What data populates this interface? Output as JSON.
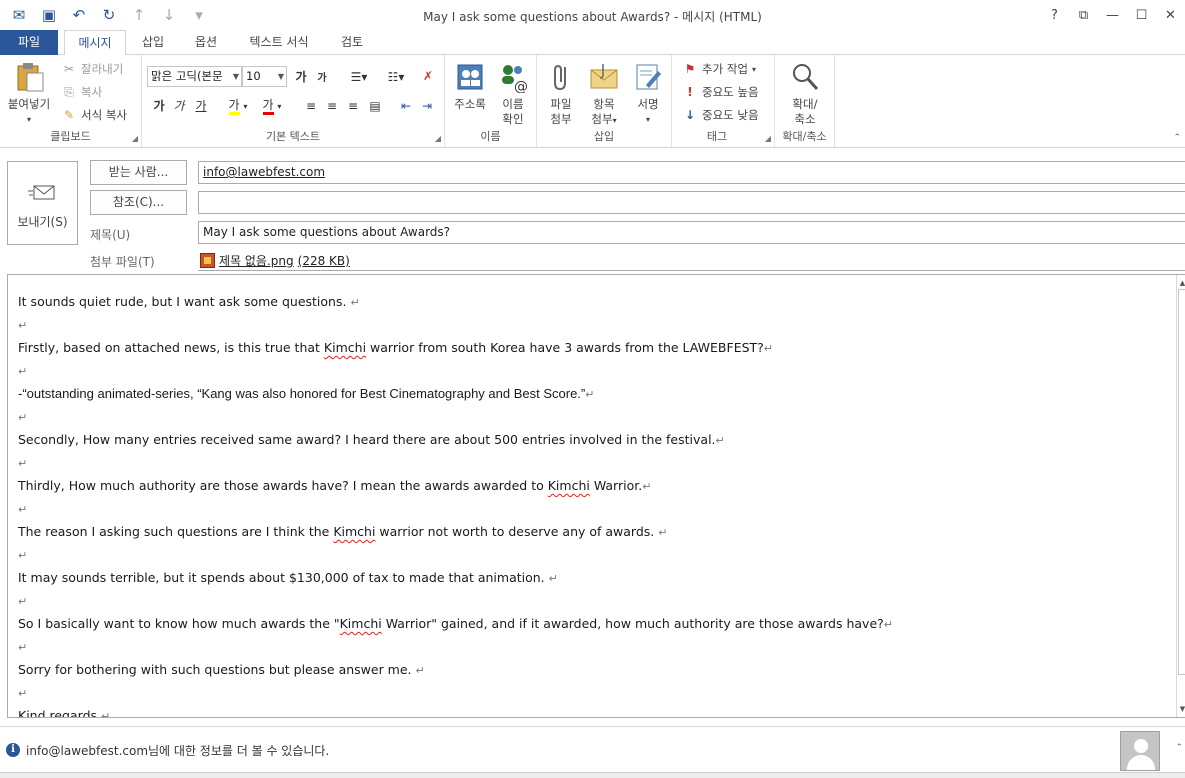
{
  "window": {
    "title": "May I ask some questions about Awards? - 메시지 (HTML)",
    "controls": [
      "?",
      "⧉",
      "—",
      "☐",
      "✕"
    ]
  },
  "tabs": [
    {
      "label": "파일"
    },
    {
      "label": "메시지"
    },
    {
      "label": "삽입"
    },
    {
      "label": "옵션"
    },
    {
      "label": "텍스트 서식"
    },
    {
      "label": "검토"
    }
  ],
  "ribbon": {
    "clipboard": {
      "label": "클립보드",
      "paste": "붙여넣기",
      "cut": "잘라내기",
      "copy": "복사",
      "format_painter": "서식 복사"
    },
    "basic_text": {
      "label": "기본 텍스트",
      "font_name": "맑은 고딕(본문",
      "font_size": "10",
      "bold": "가",
      "italic": "가",
      "underline": "가",
      "highlight": "가",
      "font_color": "가",
      "grow": "가",
      "shrink": "가"
    },
    "names": {
      "label": "이름",
      "address_book": "주소록",
      "check_names_1": "이름",
      "check_names_2": "확인"
    },
    "include": {
      "label": "삽입",
      "attach_file_1": "파일",
      "attach_file_2": "첨부",
      "attach_item_1": "항목",
      "attach_item_2": "첨부",
      "signature": "서명"
    },
    "tags": {
      "label": "태그",
      "follow_up": "추가 작업",
      "high_importance": "중요도 높음",
      "low_importance": "중요도 낮음"
    },
    "zoom": {
      "label": "확대/축소",
      "zoom_1": "확대/",
      "zoom_2": "축소"
    }
  },
  "compose": {
    "send": "보내기(S)",
    "to_button": "받는 사람...",
    "to_value": "info@lawebfest.com",
    "cc_button": "참조(C)...",
    "cc_value": "",
    "subject_label": "제목(U)",
    "subject_value": "May I ask some questions about Awards?",
    "attachment_label": "첨부 파일(T)",
    "attachment_name": "제목 없음.png",
    "attachment_size": "(228 KB)"
  },
  "body": {
    "l1": "It sounds quiet rude, but I want ask some questions.",
    "l2a": "Firstly, based on attached news, is this true that ",
    "l2b": "Kimchi",
    "l2c": " warrior from south Korea have 3 awards from the LAWEBFEST?",
    "l3": "-“outstanding animated-series, “Kang was also honored for Best Cinematography and Best Score.”",
    "l4": "Secondly, How many entries received same award? I heard there are about 500 entries involved in the festival.",
    "l5a": "Thirdly, How much authority are those awards have? I mean the awards awarded to ",
    "l5b": "Kimchi",
    "l5c": " Warrior.",
    "l6a": "The reason I asking such questions are I think the ",
    "l6b": "Kimchi",
    "l6c": " warrior not worth to deserve any of awards.",
    "l7": "It may sounds terrible, but it spends about $130,000 of tax to made that animation.",
    "l8a": "So I basically want to know how much awards the \"",
    "l8b": "Kimchi",
    "l8c": " Warrior\" gained, and if it awarded, how much authority are those awards have?",
    "l9": "Sorry for bothering with such questions but please answer me.",
    "l10": "Kind regards",
    "pilcrow": "↵"
  },
  "people_pane": {
    "text": "info@lawebfest.com님에 대한 정보를 더 볼 수 있습니다."
  }
}
